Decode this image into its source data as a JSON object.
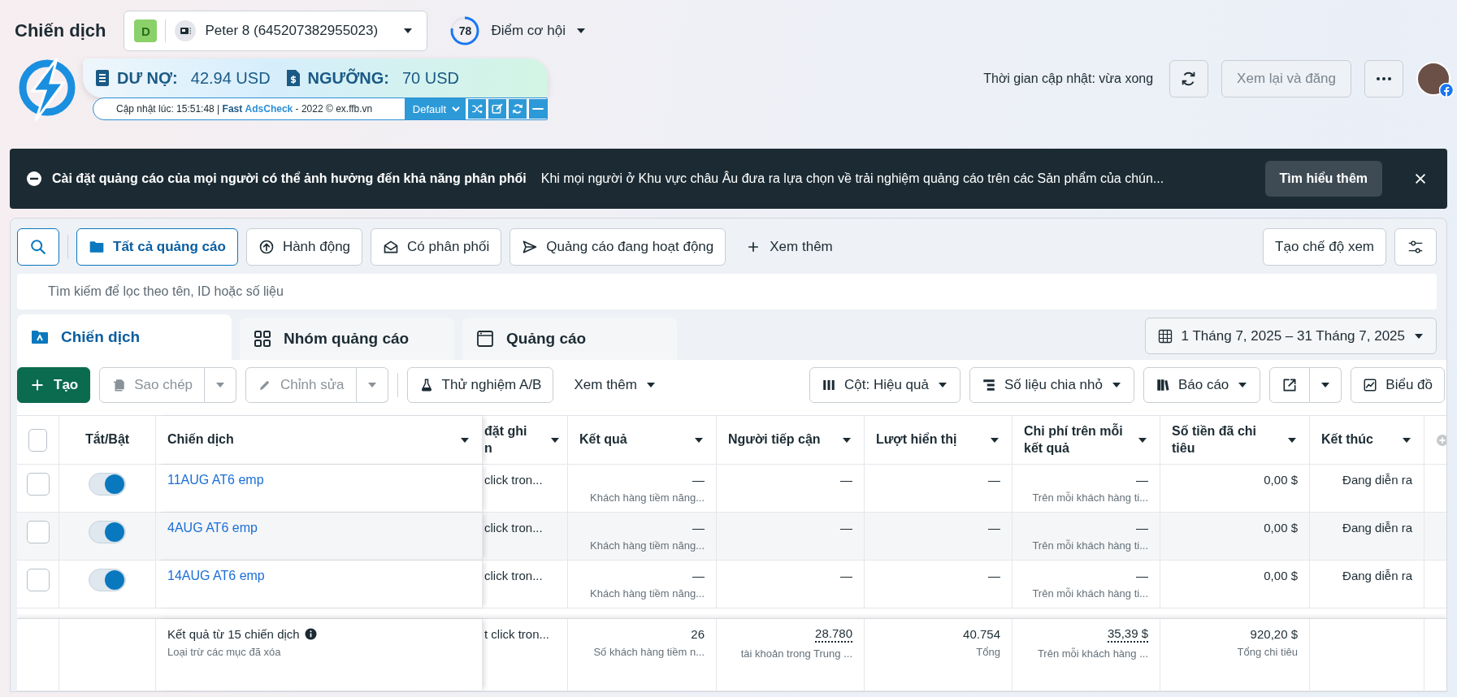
{
  "header": {
    "title": "Chiến dịch",
    "account": {
      "badge": "D",
      "name": "Peter 8 (645207382955023)"
    },
    "score": {
      "value": "78",
      "level": 0.78,
      "label": "Điểm cơ hội"
    },
    "update_text": "Thời gian cập nhật: vừa xong",
    "review_button": {
      "label": "Xem lại và đăng",
      "disabled": true
    }
  },
  "widget": {
    "debt_label": "DƯ NỢ:",
    "debt_value": "42.94 USD",
    "threshold_label": "NGƯỠNG:",
    "threshold_value": "70 USD",
    "status": "Cập nhật lúc: 15:51:48 | **Fast** **AdsCheck** - 2022 © ex.ffb.vn",
    "profile": "Default"
  },
  "banner": {
    "title": "Cài đặt quảng cáo của mọi người có thể ảnh hưởng đến khả năng phân phối",
    "text": "Khi mọi người ở Khu vực châu Âu đưa ra lựa chọn về trải nghiệm quảng cáo trên các Sản phẩm của chún...",
    "button": "Tìm hiểu thêm"
  },
  "filters": [
    {
      "kind": "folder",
      "label": "Tất cả quảng cáo",
      "selected": true
    },
    {
      "kind": "upload",
      "label": "Hành động",
      "selected": false
    },
    {
      "kind": "envelope",
      "label": "Có phân phối",
      "selected": false
    },
    {
      "kind": "send",
      "label": "Quảng cáo đang hoạt động",
      "selected": false
    }
  ],
  "more_filters": "Xem thêm",
  "create_view": "Tạo chế độ xem",
  "search": {
    "placeholder": "Tìm kiếm để lọc theo tên, ID hoặc số liệu"
  },
  "tabs": [
    {
      "kind": "campaign",
      "label": "Chiến dịch",
      "selected": true
    },
    {
      "kind": "adset",
      "label": "Nhóm quảng cáo",
      "selected": false
    },
    {
      "kind": "ad",
      "label": "Quảng cáo",
      "selected": false
    }
  ],
  "date_range": "1 Tháng 7, 2025 – 31 Tháng 7, 2025",
  "actions": [
    {
      "kind": "primary",
      "label": "Tạo"
    },
    {
      "kind": "split",
      "label": "Sao chép",
      "disabled": true
    },
    {
      "kind": "split",
      "label": "Chỉnh sửa",
      "disabled": true
    },
    {
      "kind": "separator"
    },
    {
      "kind": "button",
      "label": "Thử nghiệm A/B"
    },
    {
      "kind": "menu",
      "label": "Xem thêm"
    },
    {
      "kind": "dropdown",
      "label": "Cột: Hiệu quả"
    },
    {
      "kind": "dropdown",
      "label": "Số liệu chia nhỏ"
    },
    {
      "kind": "dropdown",
      "label": "Báo cáo"
    },
    {
      "kind": "icon_split"
    },
    {
      "kind": "button",
      "label": "Biểu đồ"
    }
  ],
  "table": {
    "select_all": {
      "checked": false
    },
    "columns": [
      "Tắt/Bật",
      "Chiến dịch",
      "đặt ghi n",
      "Kết quả",
      "Người tiếp cận",
      "Lượt hiển thị",
      "Chi phí trên mỗi kết quả",
      "Số tiền đã chi tiêu",
      "Kết thúc"
    ],
    "rows": [
      {
        "checked": false,
        "on": true,
        "name": "11AUG AT6 emp",
        "delivery_note": "click tron...",
        "result": "—",
        "result_sub": "Khách hàng tiềm năng...",
        "reach": "—",
        "impressions": "—",
        "cost": "—",
        "cost_sub": "Trên mỗi khách hàng ti...",
        "spent": "0,00 $",
        "end": "Đang diễn ra"
      },
      {
        "checked": false,
        "on": true,
        "name": "4AUG AT6 emp",
        "delivery_note": "click tron...",
        "result": "—",
        "result_sub": "Khách hàng tiềm năng...",
        "reach": "—",
        "impressions": "—",
        "cost": "—",
        "cost_sub": "Trên mỗi khách hàng ti...",
        "spent": "0,00 $",
        "end": "Đang diễn ra"
      },
      {
        "checked": false,
        "on": true,
        "name": "14AUG AT6 emp",
        "delivery_note": "click tron...",
        "result": "—",
        "result_sub": "Khách hàng tiềm năng...",
        "reach": "—",
        "impressions": "—",
        "cost": "—",
        "cost_sub": "Trên mỗi khách hàng ti...",
        "spent": "0,00 $",
        "end": "Đang diễn ra"
      }
    ],
    "footer": {
      "title": "Kết quả từ 15 chiến dịch",
      "sub": "Loại trừ các mục đã xóa",
      "delivery_note": "t click tron...",
      "result": "26",
      "result_sub": "Số khách hàng tiềm n...",
      "reach": "28.780",
      "reach_sub": "tài khoản trong Trung ...",
      "impressions": "40.754",
      "impressions_sub": "Tổng",
      "cost": "35,39 $",
      "cost_sub": "Trên mỗi khách hàng ...",
      "spent": "920,20 $",
      "spent_sub": "Tổng chi tiêu"
    }
  }
}
